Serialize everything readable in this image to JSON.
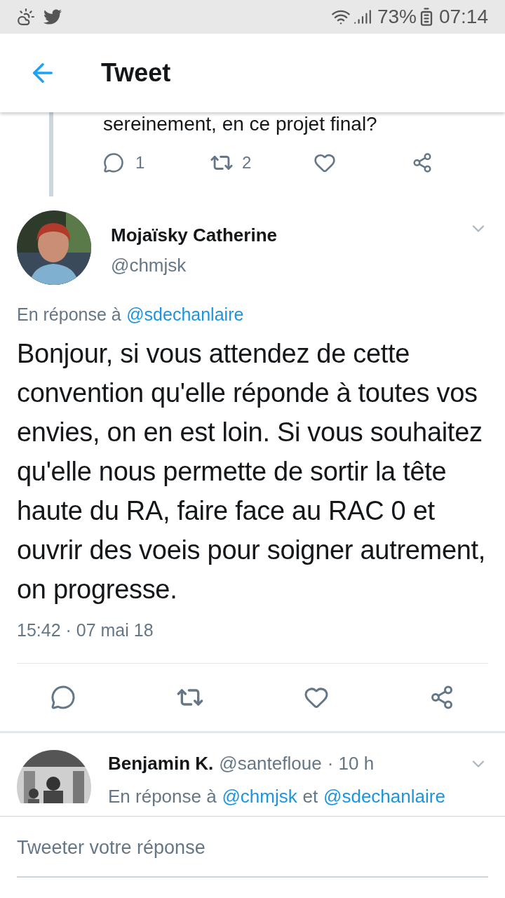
{
  "status_bar": {
    "battery": "73%",
    "time": "07:14"
  },
  "header": {
    "title": "Tweet"
  },
  "previous_tweet": {
    "text": "sereinement, en ce projet final?",
    "replies": "1",
    "retweets": "2"
  },
  "tweet": {
    "name": "Mojaïsky Catherine",
    "handle": "@chmjsk",
    "reply_to": [
      {
        "kind": "text",
        "text": "En réponse à"
      },
      {
        "kind": "mention",
        "text": "@sdechanlaire"
      }
    ],
    "body": "Bonjour, si vous attendez de cette convention qu'elle réponde à toutes vos envies, on en est loin. Si vous souhaitez qu'elle nous permette de sortir la tête haute du RA, faire face au RAC 0 et ouvrir des voeis pour soigner autrement, on progresse.",
    "timestamp": "15:42 · 07 mai 18"
  },
  "reply": {
    "name": "Benjamin K.",
    "handle": "@santefloue",
    "age": "· 10 h",
    "reply_to": [
      {
        "kind": "text",
        "text": "En réponse à"
      },
      {
        "kind": "mention",
        "text": "@chmjsk"
      },
      {
        "kind": "text",
        "text": "et"
      },
      {
        "kind": "mention",
        "text": "@sdechanlaire"
      }
    ]
  },
  "composer": {
    "placeholder": "Tweeter votre réponse"
  }
}
